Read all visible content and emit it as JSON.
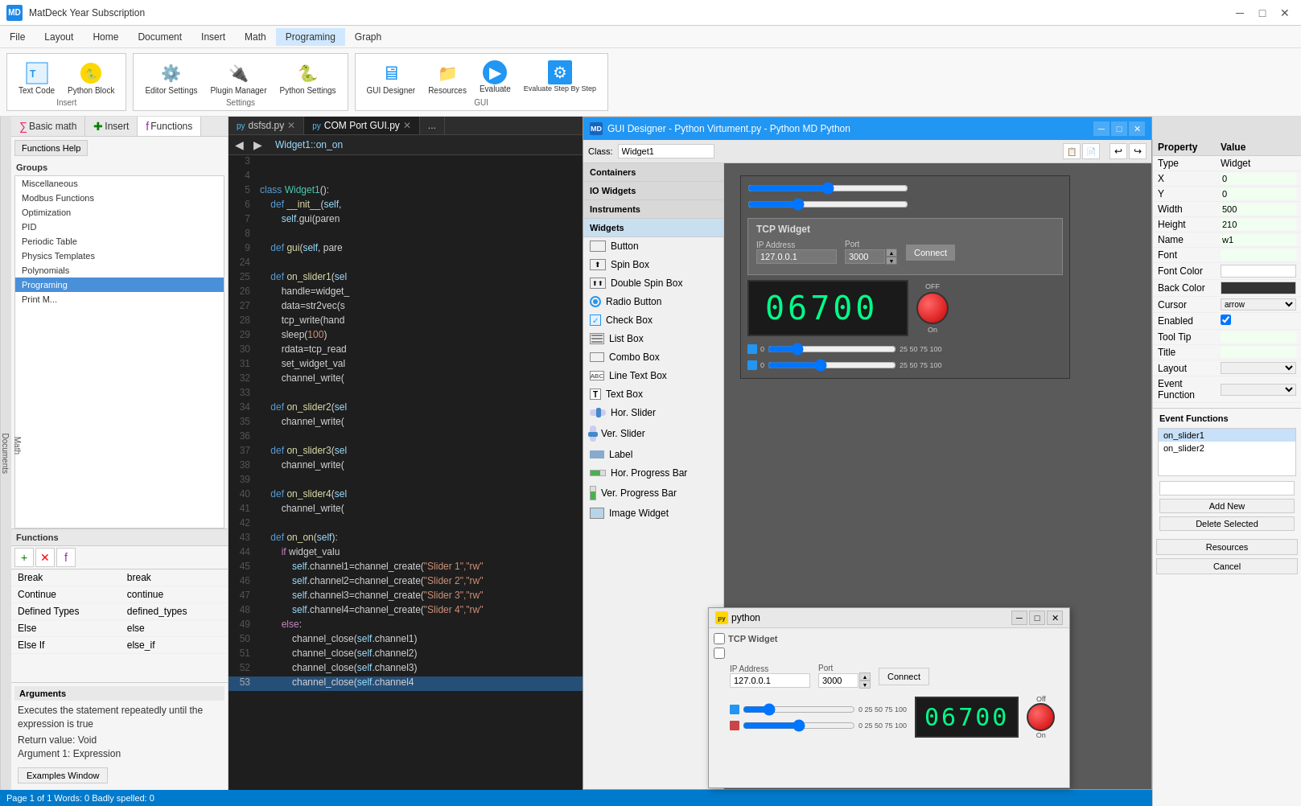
{
  "titleBar": {
    "logo": "MD",
    "title": "MatDeck Year Subscription",
    "controls": [
      "─",
      "□",
      "✕"
    ]
  },
  "menuBar": {
    "items": [
      "File",
      "Layout",
      "Home",
      "Document",
      "Insert",
      "Math",
      "Programing",
      "Graph"
    ]
  },
  "toolbar": {
    "items": [
      {
        "label": "Text Code",
        "icon": "📝",
        "group": "Insert"
      },
      {
        "label": "Python Block",
        "icon": "🐍",
        "group": "Insert"
      },
      {
        "label": "Editor Settings",
        "icon": "⚙️",
        "group": "Settings"
      },
      {
        "label": "Plugin Manager",
        "icon": "🔌",
        "group": "Settings"
      },
      {
        "label": "Python Settings",
        "icon": "🐍",
        "group": "Settings"
      },
      {
        "label": "GUI Designer",
        "icon": "🖥️",
        "group": "GUI"
      },
      {
        "label": "Resources",
        "icon": "📁",
        "group": "GUI"
      },
      {
        "label": "Evaluate",
        "icon": "▶",
        "group": "GUI"
      },
      {
        "label": "Evaluate Step By Step",
        "icon": "⏭",
        "group": "GUI"
      }
    ]
  },
  "sidebar": {
    "tabs": [
      {
        "label": "Basic math",
        "icon": "∑",
        "active": false
      },
      {
        "label": "Insert",
        "icon": "+",
        "active": false
      },
      {
        "label": "Functions",
        "icon": "f",
        "active": true
      }
    ],
    "functionsHelp": "Functions Help",
    "groupsLabel": "Groups",
    "groups": [
      "Miscellaneous",
      "Modbus Functions",
      "Optimization",
      "PID",
      "Periodic Table",
      "Physics Templates",
      "Polynomials",
      "Programing",
      "Print M..."
    ],
    "selectedGroup": "Programing",
    "functionsLabel": "Functions",
    "functionsList": [
      {
        "name": "Break",
        "value": "break"
      },
      {
        "name": "Continue",
        "value": "continue"
      },
      {
        "name": "Defined Types",
        "value": "defined_types"
      },
      {
        "name": "Else",
        "value": "else"
      },
      {
        "name": "Else If",
        "value": "else_if"
      }
    ],
    "argumentsLabel": "Arguments",
    "argumentsText": "Executes the statement repeatedly until the expression is true",
    "returnValue": "Return value: Void",
    "argument1": "Argument 1: Expression",
    "examplesBtn": "Examples Window"
  },
  "codeTabs": [
    {
      "label": "dsfsd.py",
      "active": false
    },
    {
      "label": "COM Port GUI.py",
      "active": false
    },
    {
      "label": "...",
      "active": false
    }
  ],
  "codeNavTitle": "Widget1::on_on",
  "codeLines": [
    {
      "num": "3",
      "content": ""
    },
    {
      "num": "4",
      "content": ""
    },
    {
      "num": "5",
      "content": "class Widget1():",
      "type": "class"
    },
    {
      "num": "6",
      "content": "    def __init__(self,",
      "type": "def"
    },
    {
      "num": "7",
      "content": "        self.gui(paren",
      "type": "normal"
    },
    {
      "num": "8",
      "content": ""
    },
    {
      "num": "9",
      "content": "    def gui(self, pare",
      "type": "def"
    },
    {
      "num": "24",
      "content": ""
    },
    {
      "num": "25",
      "content": "    def on_slider1(sel",
      "type": "def"
    },
    {
      "num": "26",
      "content": "        handle=widget_",
      "type": "normal"
    },
    {
      "num": "27",
      "content": "        data=str2vec(s",
      "type": "normal"
    },
    {
      "num": "28",
      "content": "        tcp_write(hand",
      "type": "normal"
    },
    {
      "num": "29",
      "content": "        sleep(100)",
      "type": "normal"
    },
    {
      "num": "30",
      "content": "        rdata=tcp_read",
      "type": "normal"
    },
    {
      "num": "31",
      "content": "        set_widget_val",
      "type": "normal"
    },
    {
      "num": "32",
      "content": "        channel_write(",
      "type": "normal"
    },
    {
      "num": "33",
      "content": ""
    },
    {
      "num": "34",
      "content": "    def on_slider2(sel",
      "type": "def"
    },
    {
      "num": "35",
      "content": "        channel_write(",
      "type": "normal"
    },
    {
      "num": "36",
      "content": ""
    },
    {
      "num": "37",
      "content": "    def on_slider3(sel",
      "type": "def"
    },
    {
      "num": "38",
      "content": "        channel_write(",
      "type": "normal"
    },
    {
      "num": "39",
      "content": ""
    },
    {
      "num": "40",
      "content": "    def on_slider4(sel",
      "type": "def"
    },
    {
      "num": "41",
      "content": "        channel_write(",
      "type": "normal"
    },
    {
      "num": "42",
      "content": ""
    },
    {
      "num": "43",
      "content": "    def on_on(self):",
      "type": "def"
    },
    {
      "num": "44",
      "content": "        if widget_valu",
      "type": "if"
    },
    {
      "num": "45",
      "content": "            self.channel1=channel_create(\"Slider 1\",\"rw\"",
      "type": "normal"
    },
    {
      "num": "46",
      "content": "            self.channel2=channel_create(\"Slider 2\",\"rw\"",
      "type": "normal"
    },
    {
      "num": "47",
      "content": "            self.channel3=channel_create(\"Slider 3\",\"rw\"",
      "type": "normal"
    },
    {
      "num": "48",
      "content": "            self.channel4=channel_create(\"Slider 4\",\"rw\"",
      "type": "normal"
    },
    {
      "num": "49",
      "content": "        else:",
      "type": "else"
    },
    {
      "num": "50",
      "content": "            channel_close(self.channel1)",
      "type": "normal"
    },
    {
      "num": "51",
      "content": "            channel_close(self.channel2)",
      "type": "normal"
    },
    {
      "num": "52",
      "content": "            channel_close(self.channel3)",
      "type": "normal"
    },
    {
      "num": "53",
      "content": "            channel_close(self.channel4",
      "type": "normal",
      "highlighted": true
    }
  ],
  "guiDesigner": {
    "title": "GUI Designer - Python Virtument.py - Python MD Python",
    "classLabel": "Class:",
    "classValue": "Widget1",
    "containers": "Containers",
    "ioWidgets": "IO Widgets",
    "instruments": "Instruments",
    "widgets": "Widgets"
  },
  "widgetList": [
    {
      "label": "Button",
      "icon": "⬜"
    },
    {
      "label": "Spin Box",
      "icon": "🔢"
    },
    {
      "label": "Double Spin Box",
      "icon": "🔢"
    },
    {
      "label": "Radio Button",
      "icon": "⦿"
    },
    {
      "label": "Check Box",
      "icon": "☑"
    },
    {
      "label": "List Box",
      "icon": "≡"
    },
    {
      "label": "Combo Box",
      "icon": "⬜"
    },
    {
      "label": "Line Text Box",
      "icon": "ABC"
    },
    {
      "label": "Text Box",
      "icon": "T"
    },
    {
      "label": "Hor. Slider",
      "icon": "—"
    },
    {
      "label": "Ver. Slider",
      "icon": "|"
    },
    {
      "label": "Label",
      "icon": "⬛"
    },
    {
      "label": "Hor. Progress Bar",
      "icon": "▬"
    },
    {
      "label": "Ver. Progress Bar",
      "icon": "▮"
    },
    {
      "label": "Image Widget",
      "icon": "🖼"
    }
  ],
  "properties": {
    "headers": [
      "Property",
      "Value"
    ],
    "rows": [
      {
        "name": "Type",
        "value": "Widget"
      },
      {
        "name": "X",
        "value": "0"
      },
      {
        "name": "Y",
        "value": "0"
      },
      {
        "name": "Width",
        "value": "500"
      },
      {
        "name": "Height",
        "value": "210"
      },
      {
        "name": "Name",
        "value": "w1"
      },
      {
        "name": "Font",
        "value": ""
      },
      {
        "name": "Font Color",
        "value": ""
      },
      {
        "name": "Back Color",
        "value": "dark"
      },
      {
        "name": "Cursor",
        "value": "arrow"
      },
      {
        "name": "Enabled",
        "value": "✓"
      },
      {
        "name": "Tool Tip",
        "value": ""
      },
      {
        "name": "Title",
        "value": ""
      },
      {
        "name": "Layout",
        "value": ""
      },
      {
        "name": "Event Function",
        "value": ""
      }
    ]
  },
  "eventFunctions": {
    "label": "Event Functions",
    "list": [
      "on_slider1",
      "on_slider2"
    ],
    "addBtn": "Add New",
    "deleteBtn": "Delete Selected"
  },
  "tcpWidget": {
    "title": "TCP Widget",
    "ipLabel": "IP Address",
    "portLabel": "Port",
    "ipValue": "127.0.0.1",
    "portValue": "3000",
    "connectBtn": "Connect",
    "display": "0 6 7 0 0",
    "onLabel": "On"
  },
  "pythonWindow": {
    "title": "python",
    "tcpTitle": "TCP Widget",
    "ipLabel": "IP Address",
    "portLabel": "Port",
    "ipValue": "127.0.0.1",
    "portValue": "3000",
    "connectBtn": "Connect",
    "onLabel": "On"
  },
  "statusBar": {
    "text": "Page 1 of 1   Words: 0   Badly spelled: 0"
  },
  "verticalTab": {
    "math": "Math",
    "documents": "Documents"
  },
  "resourcesBtn": "Resources",
  "cancelBtn": "Cancel"
}
